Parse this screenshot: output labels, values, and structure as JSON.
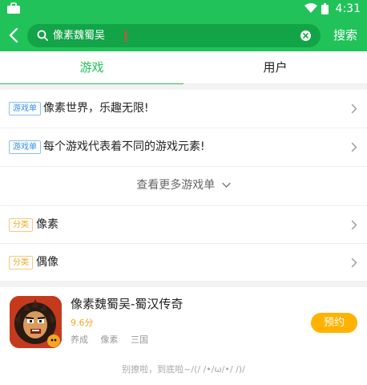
{
  "status_bar": {
    "time": "4:31",
    "icons": [
      "briefcase-icon",
      "wifi-icon",
      "battery-icon"
    ]
  },
  "search": {
    "value": "像素魏蜀吴",
    "button_label": "搜索",
    "icon": "search-icon",
    "clear_icon": "clear-icon",
    "back_icon": "back-arrow-icon"
  },
  "tabs": [
    {
      "label": "游戏",
      "active": true
    },
    {
      "label": "用户",
      "active": false
    }
  ],
  "game_lists": [
    {
      "badge": "游戏单",
      "title": "像素世界，乐趣无限!"
    },
    {
      "badge": "游戏单",
      "title": "每个游戏代表着不同的游戏元素!"
    }
  ],
  "more_label": "查看更多游戏单",
  "categories": [
    {
      "badge": "分类",
      "title": "像素"
    },
    {
      "badge": "分类",
      "title": "偶像"
    }
  ],
  "game": {
    "title": "像素魏蜀吴-蜀汉传奇",
    "score": "9.6分",
    "tags": [
      "养成",
      "像素",
      "三国"
    ],
    "action_label": "预约"
  },
  "footer_text": "别撩啦，到底啦~/(/ /•/ω/•/ /)/",
  "colors": {
    "primary": "#21c25a",
    "search_bg": "#13a448",
    "accent": "#ffb300",
    "badge_blue": "#3a8ee6",
    "badge_orange": "#f5a623"
  }
}
